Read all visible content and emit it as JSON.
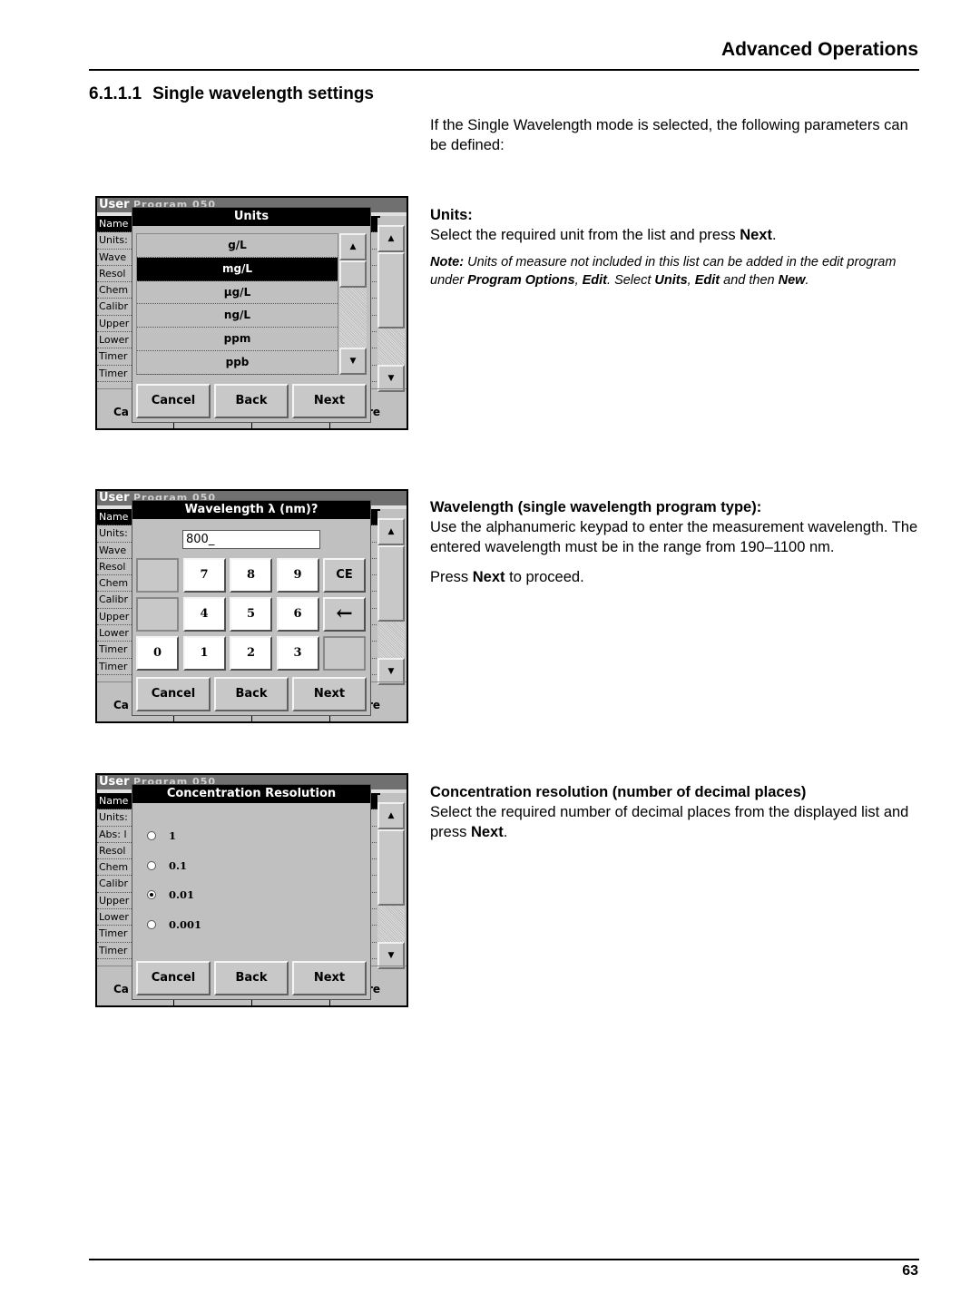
{
  "header": {
    "title": "Advanced Operations"
  },
  "section": {
    "number": "6.1.1.1",
    "title": "Single wavelength settings"
  },
  "intro": "If the Single Wavelength mode is selected, the following parameters can be defined:",
  "background_screen": {
    "title": "User",
    "title_faded": "Program  050",
    "rows": [
      "Name",
      "Units:",
      "Wave",
      "Resol",
      "Chem",
      "Calibr",
      "Upper",
      "Lower",
      "Timer",
      "Timer"
    ],
    "rows_resolution_screen": [
      "Name",
      "Units:",
      "Abs: l",
      "Resol",
      "Chem",
      "Calibr",
      "Upper",
      "Lower",
      "Timer",
      "Timer"
    ],
    "bottom_left": "Ca",
    "bottom_right": "re",
    "scroll_up": "▲",
    "scroll_down": "▼"
  },
  "dialogs": {
    "buttons": {
      "cancel": "Cancel",
      "back": "Back",
      "next": "Next"
    },
    "units": {
      "title": "Units",
      "items": [
        "g/L",
        "mg/L",
        "µg/L",
        "ng/L",
        "ppm",
        "ppb"
      ],
      "selected": "mg/L"
    },
    "wavelength": {
      "title": "Wavelength λ (nm)?",
      "value": "800_",
      "keys": [
        "",
        "7",
        "8",
        "9",
        "CE",
        "",
        "4",
        "5",
        "6",
        "←",
        "0",
        "1",
        "2",
        "3",
        ""
      ]
    },
    "resolution": {
      "title": "Concentration Resolution",
      "options": [
        "1",
        "0.1",
        "0.01",
        "0.001"
      ],
      "selected": "0.01"
    }
  },
  "descriptions": {
    "units": {
      "heading": "Units:",
      "text_pre": "Select the required unit from the list and press ",
      "text_bold": "Next",
      "text_post": ".",
      "note_label": "Note:",
      "note_1": " Units of measure not included in this list can be added in the edit program under ",
      "note_b1": "Program Options",
      "note_2": ", ",
      "note_b2": "Edit",
      "note_3": ". Select ",
      "note_b3": "Units",
      "note_4": ", ",
      "note_b4": "Edit",
      "note_5": " and then ",
      "note_b5": "New",
      "note_6": "."
    },
    "wavelength": {
      "heading": "Wavelength (single wavelength program type):",
      "text": "Use the alphanumeric keypad to enter the measurement wavelength. The entered wavelength must be in the range from 190–1100 nm.",
      "press_pre": "Press ",
      "press_bold": "Next",
      "press_post": " to proceed."
    },
    "resolution": {
      "heading": "Concentration resolution (number of decimal places)",
      "text_pre": "Select the required number of decimal places from the displayed list and press ",
      "text_bold": "Next",
      "text_post": "."
    }
  },
  "footer": {
    "page_number": "63"
  }
}
